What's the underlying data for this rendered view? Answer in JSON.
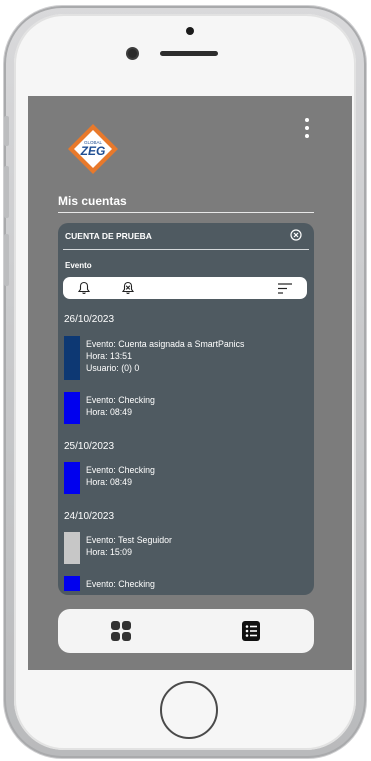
{
  "app": {
    "logo_text_top": "GLOBAL",
    "logo_text_main": "ZEG",
    "section_title": "Mis cuentas"
  },
  "account": {
    "name": "CUENTA DE PRUEBA",
    "events_label": "Evento"
  },
  "colors": {
    "screen_bg": "#7c7c7c",
    "card_bg": "#4f5a61",
    "logo_orange": "#e8792b",
    "logo_blue": "#1f4e93",
    "bar_navy": "#0d3873",
    "bar_blue": "#0000ee",
    "bar_gray": "#c7c7c7"
  },
  "groups": [
    {
      "date": "26/10/2023",
      "events": [
        {
          "lines": [
            "Evento: Cuenta asignada a SmartPanics",
            "Hora: 13:51",
            "Usuario: (0) 0"
          ],
          "color": "#0d3873"
        },
        {
          "lines": [
            "Evento: Checking",
            "Hora: 08:49"
          ],
          "color": "#0000ee"
        }
      ]
    },
    {
      "date": "25/10/2023",
      "events": [
        {
          "lines": [
            "Evento: Checking",
            "Hora: 08:49"
          ],
          "color": "#0000ee"
        }
      ]
    },
    {
      "date": "24/10/2023",
      "events": [
        {
          "lines": [
            "Evento: Test Seguidor",
            "Hora: 15:09"
          ],
          "color": "#c7c7c7"
        },
        {
          "lines": [
            "Evento: Checking"
          ],
          "color": "#0000ee"
        }
      ]
    }
  ],
  "icons": {
    "menu": "more-vertical-icon",
    "close": "close-circle-icon",
    "filter_all": "bell-icon",
    "filter_cleared": "bell-off-icon",
    "sort": "sort-icon",
    "nav_home": "grid-icon",
    "nav_list": "list-icon"
  }
}
